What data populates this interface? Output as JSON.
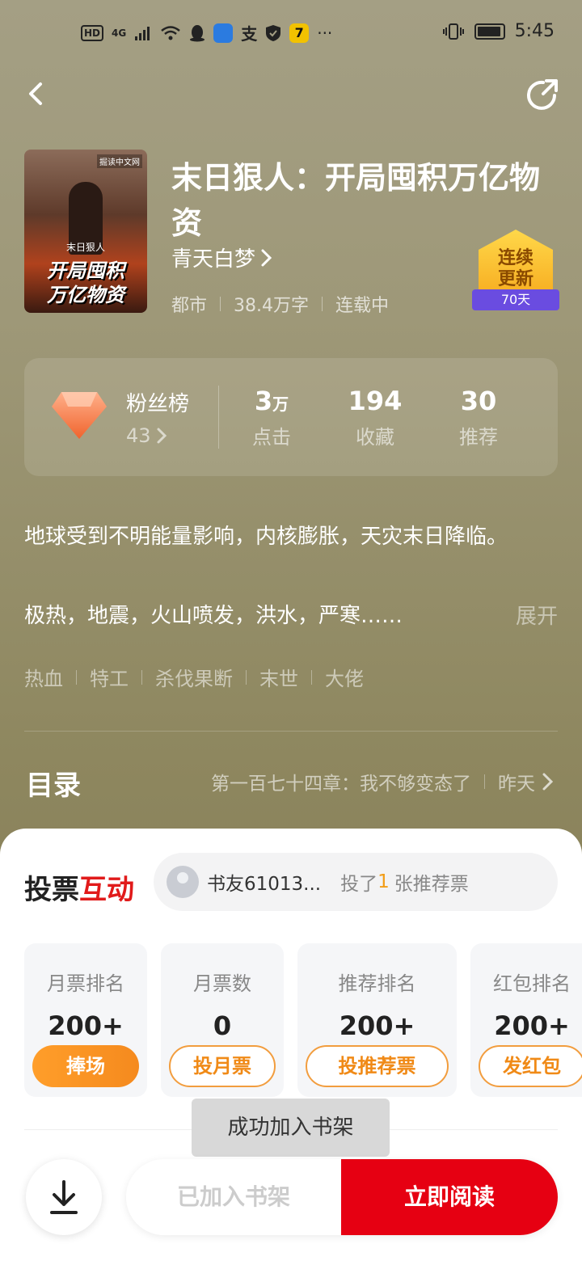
{
  "status_bar": {
    "hd": "HD",
    "network": "4G",
    "more": "···",
    "time": "5:45"
  },
  "book": {
    "cover": {
      "publisher": "掘读中文网",
      "series": "末日狠人",
      "line1": "开局囤积",
      "line2": "万亿物资"
    },
    "title": "末日狠人：开局囤积万亿物资",
    "author": "青天白梦",
    "genre": "都市",
    "word_count": "38.4万字",
    "status": "连载中",
    "badge": {
      "line1": "连续",
      "line2": "更新",
      "days": "70天"
    }
  },
  "stats": {
    "fans_label": "粉丝榜",
    "fans_count": "43",
    "clicks_value": "3",
    "clicks_unit": "万",
    "clicks_label": "点击",
    "favorites_value": "194",
    "favorites_label": "收藏",
    "recommend_value": "30",
    "recommend_label": "推荐"
  },
  "description": {
    "line1": "地球受到不明能量影响，内核膨胀，天灾末日降临。",
    "line2": "极热，地震，火山喷发，洪水，严寒……",
    "expand_label": "展开"
  },
  "tags": [
    "热血",
    "特工",
    "杀伐果断",
    "末世",
    "大佬"
  ],
  "toc": {
    "title": "目录",
    "latest_chapter": "第一百七十四章：我不够变态了",
    "updated": "昨天"
  },
  "vote": {
    "title_black": "投票",
    "title_red": "互动",
    "voter_name": "书友61013...",
    "voted_prefix": "投了",
    "voted_count": "1",
    "voted_suffix": "张推荐票",
    "cards": [
      {
        "label": "月票排名",
        "value": "200+",
        "button": "捧场"
      },
      {
        "label": "月票数",
        "value": "0",
        "button": "投月票"
      },
      {
        "label": "推荐排名",
        "value": "200+",
        "button": "投推荐票"
      },
      {
        "label": "红包排名",
        "value": "200+",
        "button": "发红包"
      }
    ]
  },
  "toast": "成功加入书架",
  "bottom_bar": {
    "added_label": "已加入书架",
    "read_label": "立即阅读"
  },
  "colors": {
    "accent_red": "#e60012",
    "accent_orange": "#f58a1e"
  }
}
